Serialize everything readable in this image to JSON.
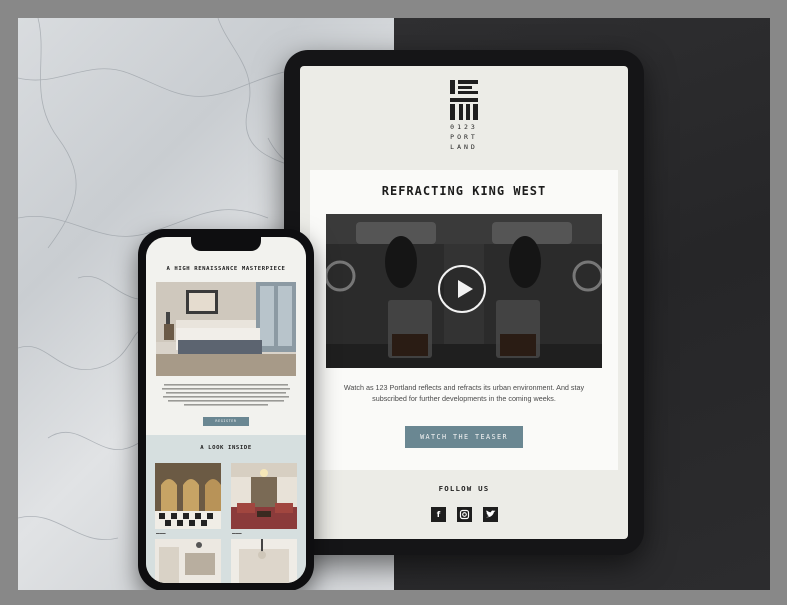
{
  "tablet": {
    "logo_text": "0123\nPORT\nLAND",
    "headline": "REFRACTING KING WEST",
    "description": "Watch as 123 Portland reflects and refracts its urban environment. And stay subscribed for further developments in the coming weeks.",
    "cta_label": "WATCH THE TEASER",
    "follow_label": "FOLLOW US",
    "social": [
      {
        "icon": "facebook-icon",
        "glyph": "f"
      },
      {
        "icon": "instagram-icon",
        "glyph": "◎"
      },
      {
        "icon": "twitter-icon",
        "glyph": "🐦"
      }
    ]
  },
  "phone": {
    "headline": "A HIGH RENAISSANCE MASTERPIECE",
    "cta_label": "REGISTER",
    "section_title": "A LOOK INSIDE"
  },
  "colors": {
    "accent": "#6a8792",
    "email_background": "#ecece7",
    "look_inside_background": "#d6dfdf"
  }
}
